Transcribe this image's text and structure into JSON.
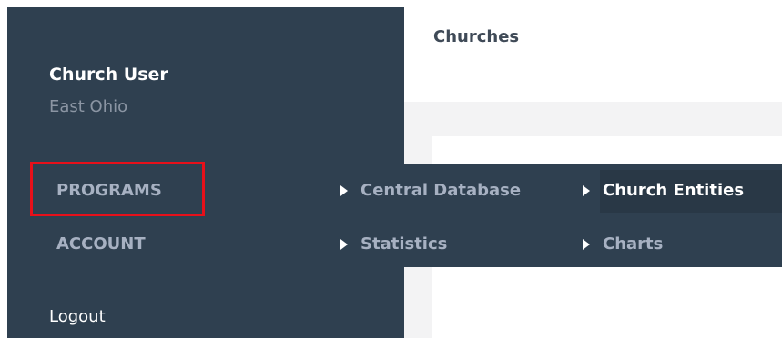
{
  "sidebar": {
    "user_name": "Church User",
    "user_org": "East Ohio",
    "nav": {
      "programs": "PROGRAMS",
      "account": "ACCOUNT"
    },
    "logout": "Logout"
  },
  "main": {
    "page_title": "Churches"
  },
  "submenu": {
    "level1": {
      "central_database": "Central Database",
      "statistics": "Statistics"
    },
    "level2": {
      "church_entities": "Church Entities",
      "charts": "Charts"
    }
  },
  "colors": {
    "sidebar_bg": "#2f4050",
    "highlight": "#e8101a",
    "hover_bg": "#293846",
    "nav_text": "#a7b1c2"
  },
  "icons": {
    "submenu_arrow": "caret-right-icon"
  }
}
